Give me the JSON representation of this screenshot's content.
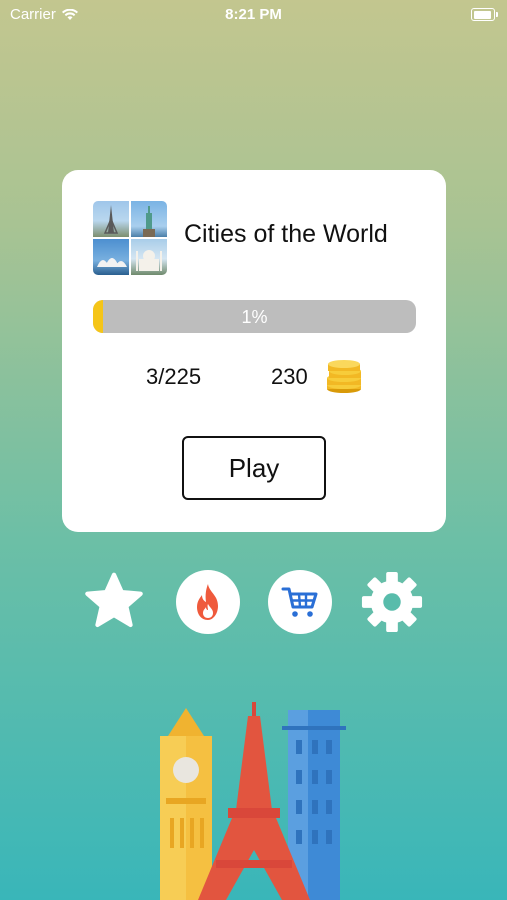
{
  "status_bar": {
    "carrier": "Carrier",
    "time": "8:21 PM"
  },
  "card": {
    "title": "Cities of the World",
    "progress_label": "1%",
    "progress": 0.01,
    "levels_done": "3/225",
    "coins": "230",
    "play_label": "Play"
  },
  "icons": {
    "favorites": "star-icon",
    "hot": "fire-icon",
    "shop": "cart-icon",
    "settings": "gear-icon"
  },
  "colors": {
    "progress_fill": "#f5c518",
    "progress_track": "#bdbdbd",
    "fire": "#ef5a3c",
    "cart": "#2a6fd6"
  }
}
